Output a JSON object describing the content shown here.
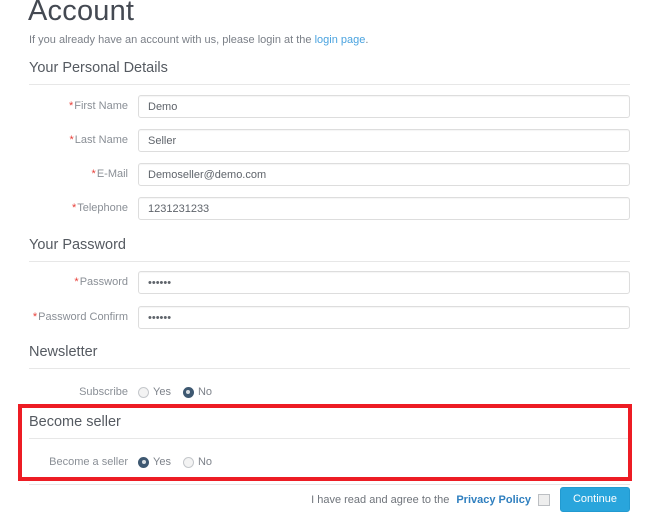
{
  "page": {
    "title": "Account",
    "subtitle_before": "If you already have an account with us, please login at the ",
    "subtitle_link": "login page",
    "subtitle_after": "."
  },
  "sections": {
    "personal": {
      "legend": "Your Personal Details",
      "fields": [
        {
          "label": "First Name",
          "required": true,
          "value": "Demo",
          "placeholder": "First Name"
        },
        {
          "label": "Last Name",
          "required": true,
          "value": "Seller",
          "placeholder": "Last Name"
        },
        {
          "label": "E-Mail",
          "required": true,
          "value": "Demoseller@demo.com",
          "placeholder": "E-Mail"
        },
        {
          "label": "Telephone",
          "required": true,
          "value": "1231231233",
          "placeholder": "Telephone"
        }
      ]
    },
    "password": {
      "legend": "Your Password",
      "fields": [
        {
          "label": "Password",
          "required": true,
          "value": "••••••",
          "placeholder": "Password"
        },
        {
          "label": "Password Confirm",
          "required": true,
          "value": "••••••",
          "placeholder": "Password Confirm"
        }
      ]
    },
    "newsletter": {
      "legend": "Newsletter",
      "row_label": "Subscribe",
      "options": [
        {
          "label": "Yes",
          "selected": false
        },
        {
          "label": "No",
          "selected": true
        }
      ]
    },
    "seller": {
      "legend": "Become seller",
      "row_label": "Become a seller",
      "options": [
        {
          "label": "Yes",
          "selected": true
        },
        {
          "label": "No",
          "selected": false
        }
      ]
    }
  },
  "footer": {
    "agree_text": "I have read and agree to the ",
    "privacy_link": "Privacy Policy",
    "agree_checked": false,
    "continue_label": "Continue"
  },
  "colors": {
    "required_asterisk": "#e8403a",
    "link": "#4aa3df",
    "privacy_link": "#2f7fbf",
    "button": "#29a5dc",
    "highlight_border": "#ed1c24",
    "radio_selected": "#3e5871"
  }
}
